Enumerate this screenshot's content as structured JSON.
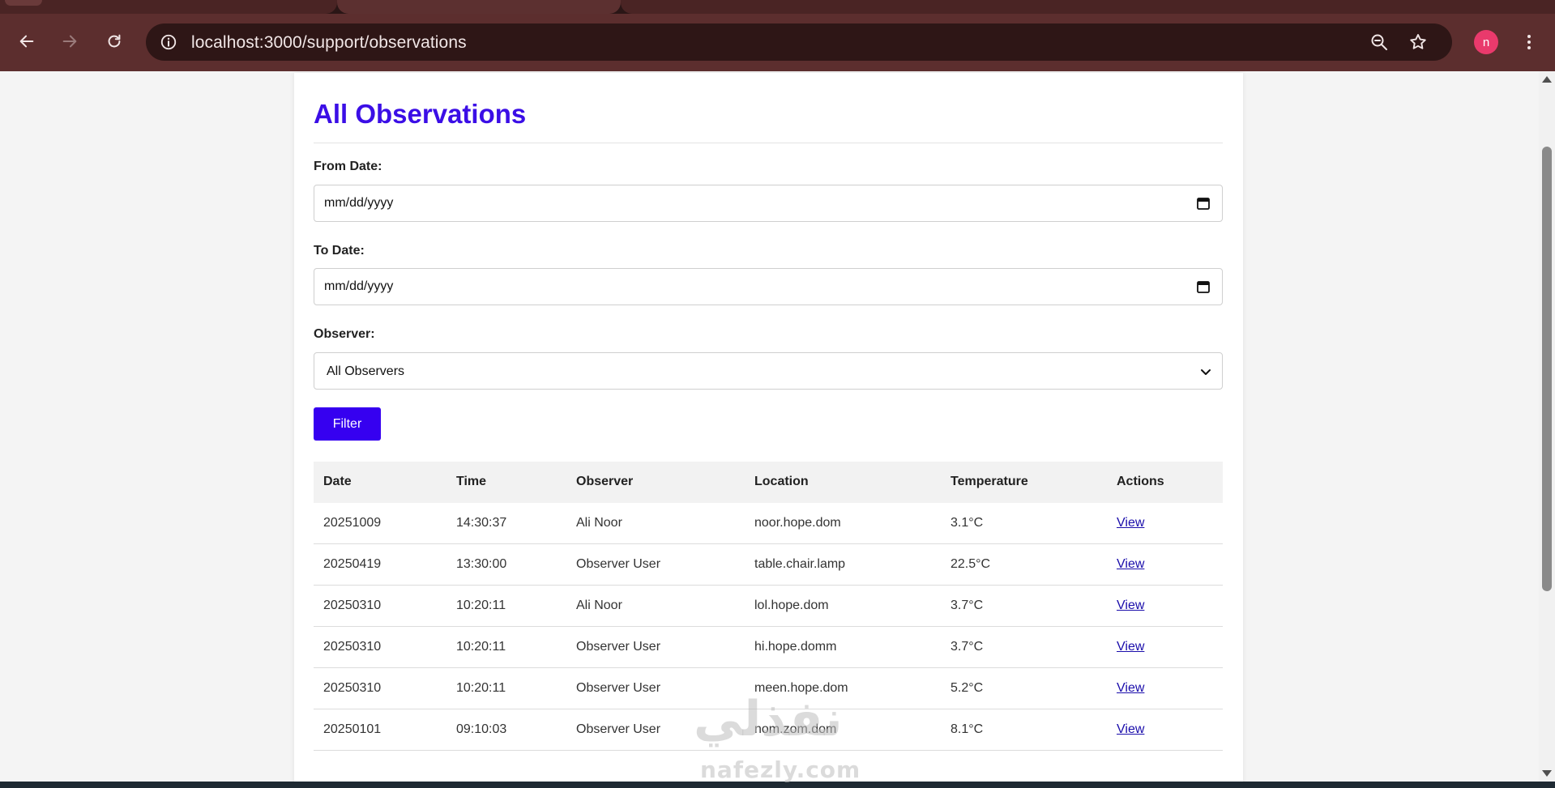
{
  "browser": {
    "url": "localhost:3000/support/observations",
    "avatar_initial": "n"
  },
  "page": {
    "title": "All Observations"
  },
  "filters": {
    "from_date": {
      "label": "From Date:",
      "placeholder": "mm/dd/yyyy"
    },
    "to_date": {
      "label": "To Date:",
      "placeholder": "mm/dd/yyyy"
    },
    "observer": {
      "label": "Observer:",
      "selected": "All Observers"
    },
    "filter_button": "Filter"
  },
  "table": {
    "headers": [
      "Date",
      "Time",
      "Observer",
      "Location",
      "Temperature",
      "Actions"
    ],
    "rows": [
      {
        "date": "20251009",
        "time": "14:30:37",
        "observer": "Ali Noor",
        "location": "noor.hope.dom",
        "temperature": "3.1°C",
        "action": "View"
      },
      {
        "date": "20250419",
        "time": "13:30:00",
        "observer": "Observer User",
        "location": "table.chair.lamp",
        "temperature": "22.5°C",
        "action": "View"
      },
      {
        "date": "20250310",
        "time": "10:20:11",
        "observer": "Ali Noor",
        "location": "lol.hope.dom",
        "temperature": "3.7°C",
        "action": "View"
      },
      {
        "date": "20250310",
        "time": "10:20:11",
        "observer": "Observer User",
        "location": "hi.hope.domm",
        "temperature": "3.7°C",
        "action": "View"
      },
      {
        "date": "20250310",
        "time": "10:20:11",
        "observer": "Observer User",
        "location": "meen.hope.dom",
        "temperature": "5.2°C",
        "action": "View"
      },
      {
        "date": "20250101",
        "time": "09:10:03",
        "observer": "Observer User",
        "location": "nom.zom.dom",
        "temperature": "8.1°C",
        "action": "View"
      }
    ]
  },
  "watermark": {
    "arabic": "نفذلي",
    "latin": "nafezly.com"
  },
  "colors": {
    "accent": "#3600f0",
    "title": "#3b0ee6",
    "chrome": "#5c2e2e",
    "avatar": "#e93a6c"
  }
}
